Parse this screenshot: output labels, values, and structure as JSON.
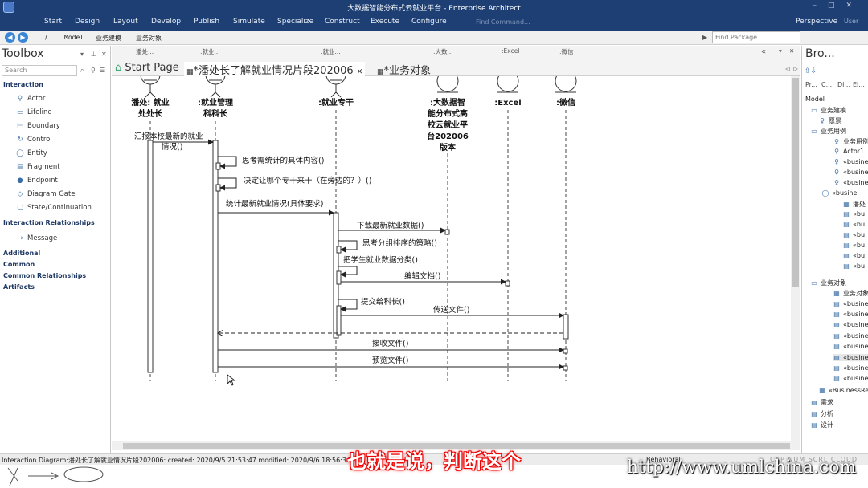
{
  "window": {
    "title": "大数据智能分布式云就业平台 - Enterprise Architect"
  },
  "ribbon": {
    "tabs": [
      "Start",
      "Design",
      "Layout",
      "Develop",
      "Publish",
      "Simulate",
      "Specialize",
      "Construct",
      "Execute",
      "Configure"
    ],
    "find_command": "Find Command...",
    "perspective": "Perspective",
    "user": "User"
  },
  "address": {
    "root": "/",
    "path": [
      "Model",
      "业务建模",
      "业务对象"
    ],
    "find_package": "Find Package"
  },
  "toolbox": {
    "title": "Toolbox",
    "search_placeholder": "Search",
    "sections": {
      "interaction": "Interaction",
      "relationships": "Interaction Relationships",
      "additional": "Additional",
      "common": "Common",
      "common_rel": "Common Relationships",
      "artifacts": "Artifacts"
    },
    "items": [
      "Actor",
      "Lifeline",
      "Boundary",
      "Control",
      "Entity",
      "Fragment",
      "Endpoint",
      "Diagram Gate",
      "State/Continuation"
    ],
    "rel_items": [
      "Message"
    ]
  },
  "doc_tabs": {
    "lifeline_headers": [
      "潘处...",
      ":就业...",
      ":就业...",
      ":大数...",
      ":Excel",
      ":微信"
    ],
    "tabs": [
      "Start Page",
      "*潘处长了解就业情况片段202006",
      "*业务对象"
    ]
  },
  "diagram": {
    "lifelines": [
      {
        "name1": "潘处: 就业",
        "name2": "处处长"
      },
      {
        "name1": ":就业管理",
        "name2": "科科长"
      },
      {
        "name1": ":就业专干",
        "name2": ""
      },
      {
        "name1": ":大数据智",
        "name2": "能分布式高",
        "name3": "校云就业平",
        "name4": "台202006",
        "name5": "版本"
      },
      {
        "name1": ":Excel",
        "name2": ""
      },
      {
        "name1": ":微信",
        "name2": ""
      }
    ],
    "messages": {
      "m1a": "汇报本校最新的就业",
      "m1b": "情况()",
      "m2": "思考需统计的具体内容()",
      "m3": "决定让哪个专干来干（在旁边的？）()",
      "m4": "统计最新就业情况(具体要求)",
      "m5": "下载最新就业数据()",
      "m6": "思考分组排序的策略()",
      "m7": "把学生就业数据分类()",
      "m8": "编辑文档()",
      "m9": "提交给科长()",
      "m10": "传送文件()",
      "m11": "接收文件()",
      "m12": "预览文件()"
    }
  },
  "browser": {
    "title": "Bro...",
    "tabs": [
      "Pr...",
      "C...",
      "Di...",
      "El..."
    ],
    "tree": [
      "Model",
      "业务建模",
      "愿景",
      "业务用例",
      "业务用例",
      "Actor1",
      "«busine",
      "«busine",
      "«busine",
      "«busine",
      "潘处",
      "«bu",
      "«bu",
      "«bu",
      "«bu",
      "«bu",
      "«bu",
      "业务对象",
      "业务对象",
      "«busine",
      "«busine",
      "«busine",
      "«busine",
      "«busine",
      "«busine",
      "«busine",
      "«busine",
      "«BusinessRe",
      "需求",
      "分析",
      "设计"
    ]
  },
  "status": {
    "info": "Interaction Diagram:潘处长了解就业情况片段202006:  created: 2020/9/5 21:53:47  modified: 2020/9/6 18:56:34",
    "behavior": "Behavioral",
    "keys": "CAP  NUM  SCRL  CLOUD"
  },
  "overlay": {
    "subtitle": "也就是说，判断这个",
    "watermark": "http://www.umlchina.com"
  },
  "colors": {
    "titlebar": "#1d3f73",
    "accent": "#3a86d6",
    "subtitle_outline": "#e00000"
  }
}
